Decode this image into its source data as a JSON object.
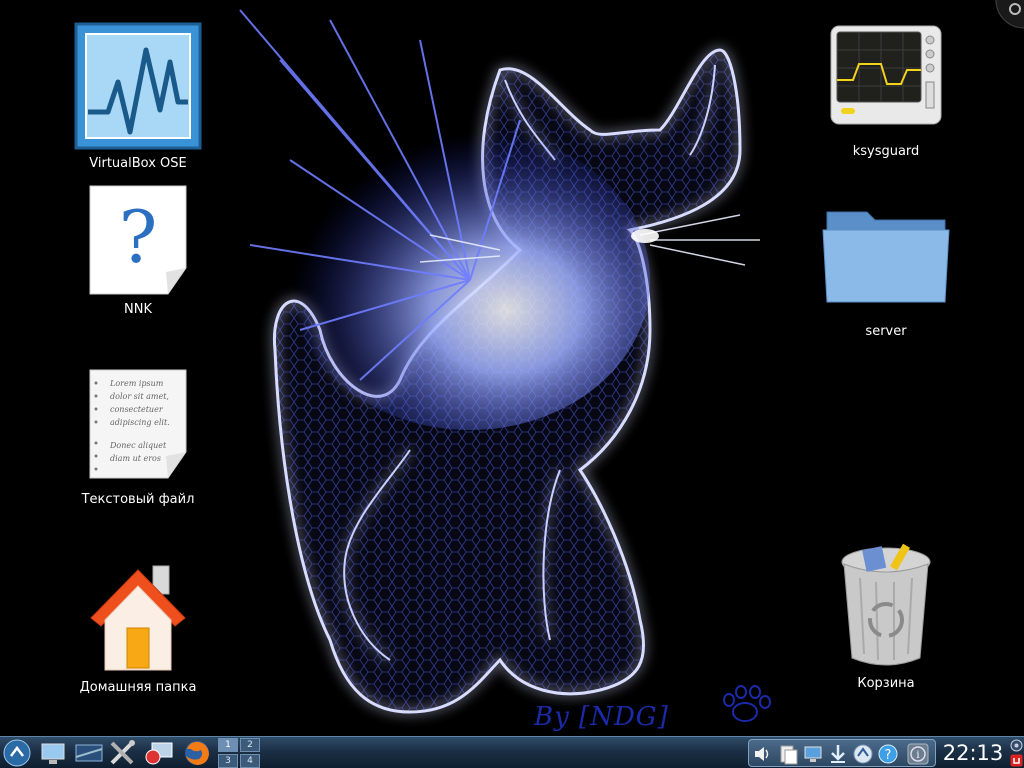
{
  "desktop": {
    "icons": [
      {
        "label": "VirtualBox OSE"
      },
      {
        "label": "NNK"
      },
      {
        "label": "Текстовый файл"
      },
      {
        "label": "Домашняя папка"
      },
      {
        "label": "ksysguard"
      },
      {
        "label": "server"
      },
      {
        "label": "Корзина"
      }
    ],
    "text_file_preview": [
      "Lorem ipsum",
      "dolor sit amet,",
      "consectetuer",
      "adipiscing elit.",
      "Donec aliquet",
      "diam ut eros"
    ],
    "wallpaper_signature": "By [NDG]"
  },
  "taskbar": {
    "launchers": [
      "application-menu-icon",
      "desktop-show-icon",
      "monitor-icon",
      "tools-icon",
      "remote-desktop-icon",
      "firefox-icon"
    ],
    "pager": [
      "1",
      "2",
      "3",
      "4"
    ],
    "active_desktop": "1",
    "tray": [
      "volume-icon",
      "clipboard-icon",
      "network-icon",
      "download-icon",
      "update-icon",
      "help-icon",
      "info-icon"
    ],
    "clock": "22:13"
  },
  "colors": {
    "panel": "#1b2f45",
    "wallpaper_glow": "#3b4bff"
  }
}
